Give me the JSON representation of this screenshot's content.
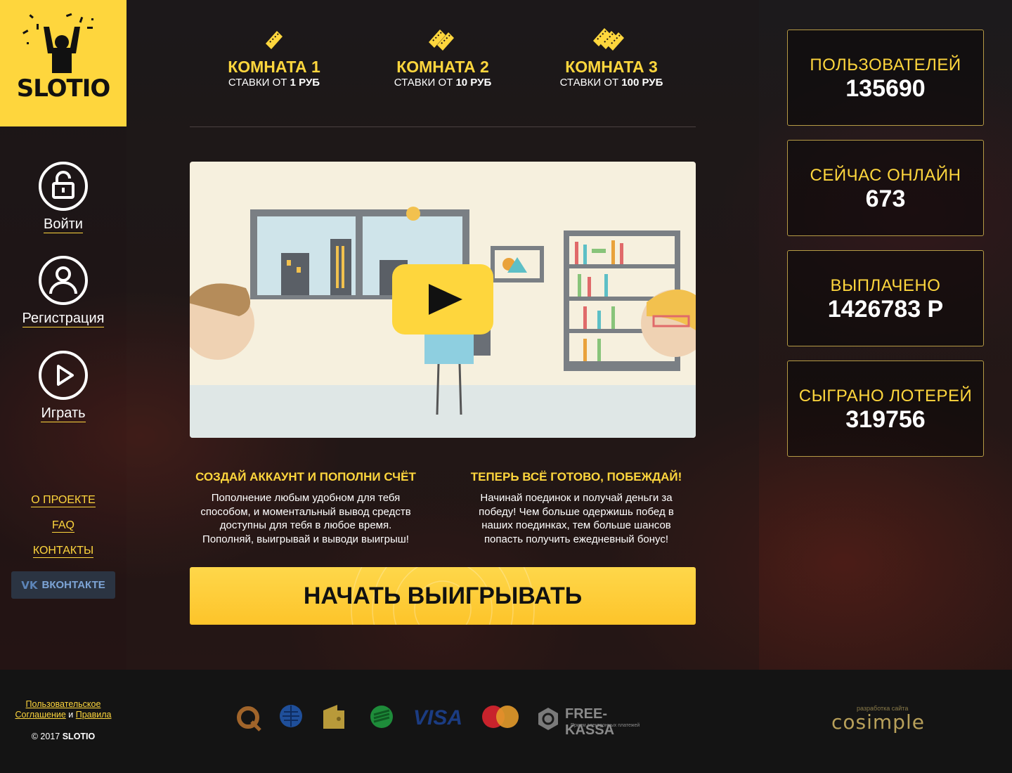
{
  "brand": {
    "logo_text": "SLOTIO"
  },
  "sidebar": {
    "nav": [
      {
        "label": "Войти",
        "icon": "lock-icon"
      },
      {
        "label": "Регистрация",
        "icon": "user-icon"
      },
      {
        "label": "Играть",
        "icon": "play-icon"
      }
    ],
    "links": [
      "О ПРОЕКТЕ",
      "FAQ",
      "КОНТАКТЫ"
    ],
    "vk": {
      "logo": "VK",
      "label": "ВКОНТАКТЕ"
    }
  },
  "rooms": [
    {
      "title": "КОМНАТА 1",
      "prefix": "СТАВКИ ОТ ",
      "amount": "1 РУБ",
      "icon": "ticket-icon"
    },
    {
      "title": "КОМНАТА 2",
      "prefix": "СТАВКИ ОТ ",
      "amount": "10 РУБ",
      "icon": "tickets-double-icon"
    },
    {
      "title": "КОМНАТА 3",
      "prefix": "СТАВКИ ОТ ",
      "amount": "100 РУБ",
      "icon": "tickets-triple-icon"
    }
  ],
  "steps": [
    {
      "title": "СОЗДАЙ АККАУНТ И ПОПОЛНИ СЧЁТ",
      "lines": [
        "Пополнение любым удобном для тебя",
        "способом, и моментальный вывод средств",
        "доступны для тебя в любое время.",
        "Пополняй, выигрывай и выводи выигрыш!"
      ]
    },
    {
      "title": "ТЕПЕРЬ ВСЁ ГОТОВО, ПОБЕЖДАЙ!",
      "lines": [
        "Начинай поединок и получай деньги за",
        "победу! Чем больше одержишь побед в",
        "наших поединках, тем больше шансов",
        "попасть получить ежедневный бонус!"
      ]
    }
  ],
  "cta": {
    "label": "НАЧАТЬ ВЫИГРЫВАТЬ"
  },
  "stats": [
    {
      "label": "ПОЛЬЗОВАТЕЛЕЙ",
      "value": "135690"
    },
    {
      "label": "СЕЙЧАС ОНЛАЙН",
      "value": "673"
    },
    {
      "label": "ВЫПЛАЧЕНО",
      "value": "1426783 Р"
    },
    {
      "label": "СЫГРАНО ЛОТЕРЕЙ",
      "value": "319756"
    }
  ],
  "footer": {
    "agreement_1": "Пользовательское",
    "agreement_2": "Соглашение",
    "and": " и ",
    "rules": "Правила",
    "copyright": "© 2017 ",
    "copyright_brand": "SLOTIO",
    "payments": [
      "qiwi-icon",
      "webmoney-icon",
      "yandex-money-icon",
      "sberbank-icon",
      "visa-icon",
      "mastercard-icon",
      "free-kassa-icon"
    ],
    "visa_text": "VISA",
    "freekassa_name": "FREE-KASSA",
    "freekassa_tag": "Прием электронных платежей",
    "dev_small": "разработка сайта",
    "dev_name": "cosimple"
  },
  "colors": {
    "accent": "#fed63d",
    "footer_bg": "#141414"
  }
}
